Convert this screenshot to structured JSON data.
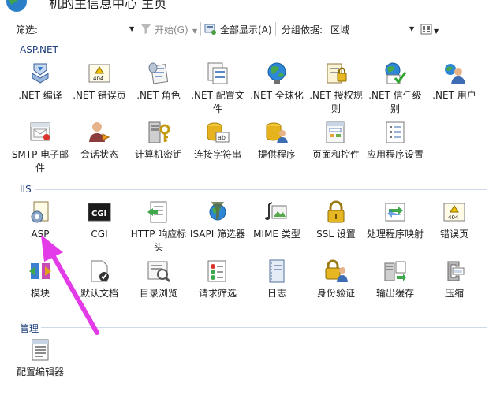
{
  "window": {
    "title": "机的主信息中心 主页"
  },
  "toolbar": {
    "filter_label": "筛选:",
    "start_label": "开始(G)",
    "show_all_label": "全部显示(A)",
    "group_by_label": "分组依据:",
    "group_by_value": "区域"
  },
  "sections": [
    {
      "title": "ASP.NET",
      "items": [
        {
          "label": ".NET 编译",
          "icon": "net-compilation-icon"
        },
        {
          "label": ".NET 错误页",
          "icon": "net-error-pages-icon"
        },
        {
          "label": ".NET 角色",
          "icon": "net-roles-icon"
        },
        {
          "label": ".NET 配置文件",
          "icon": "net-profile-icon"
        },
        {
          "label": ".NET 全球化",
          "icon": "net-globalization-icon"
        },
        {
          "label": ".NET 授权规则",
          "icon": "net-authorization-icon"
        },
        {
          "label": ".NET 信任级别",
          "icon": "net-trust-levels-icon"
        },
        {
          "label": ".NET 用户",
          "icon": "net-users-icon"
        },
        {
          "label": "SMTP 电子邮件",
          "icon": "smtp-email-icon"
        },
        {
          "label": "会话状态",
          "icon": "session-state-icon"
        },
        {
          "label": "计算机密钥",
          "icon": "machine-key-icon"
        },
        {
          "label": "连接字符串",
          "icon": "connection-strings-icon"
        },
        {
          "label": "提供程序",
          "icon": "providers-icon"
        },
        {
          "label": "页面和控件",
          "icon": "pages-controls-icon"
        },
        {
          "label": "应用程序设置",
          "icon": "app-settings-icon"
        }
      ]
    },
    {
      "title": "IIS",
      "items": [
        {
          "label": "ASP",
          "icon": "asp-icon"
        },
        {
          "label": "CGI",
          "icon": "cgi-icon"
        },
        {
          "label": "HTTP 响应标头",
          "icon": "http-headers-icon"
        },
        {
          "label": "ISAPI 筛选器",
          "icon": "isapi-filters-icon"
        },
        {
          "label": "MIME 类型",
          "icon": "mime-types-icon"
        },
        {
          "label": "SSL 设置",
          "icon": "ssl-settings-icon"
        },
        {
          "label": "处理程序映射",
          "icon": "handler-mappings-icon"
        },
        {
          "label": "错误页",
          "icon": "error-pages-icon"
        },
        {
          "label": "模块",
          "icon": "modules-icon"
        },
        {
          "label": "默认文档",
          "icon": "default-document-icon"
        },
        {
          "label": "目录浏览",
          "icon": "directory-browsing-icon"
        },
        {
          "label": "请求筛选",
          "icon": "request-filtering-icon"
        },
        {
          "label": "日志",
          "icon": "logging-icon"
        },
        {
          "label": "身份验证",
          "icon": "authentication-icon"
        },
        {
          "label": "输出缓存",
          "icon": "output-caching-icon"
        },
        {
          "label": "压缩",
          "icon": "compression-icon"
        }
      ]
    },
    {
      "title": "管理",
      "items": [
        {
          "label": "配置编辑器",
          "icon": "configuration-editor-icon"
        }
      ]
    }
  ]
}
